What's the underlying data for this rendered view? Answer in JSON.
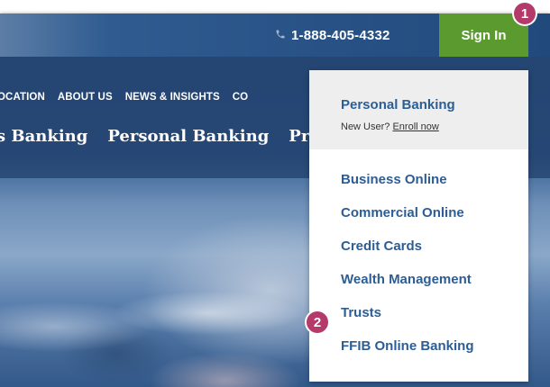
{
  "header": {
    "phone": "1-888-405-4332",
    "phone_icon": "phone-icon",
    "sign_in": "Sign In"
  },
  "nav": {
    "row1": [
      "OCATION",
      "ABOUT US",
      "NEWS & INSIGHTS",
      "CO"
    ],
    "row2": [
      "s Banking",
      "Personal Banking",
      "Pri"
    ]
  },
  "dropdown": {
    "title": "Personal Banking",
    "new_user": "New User?",
    "enroll": "Enroll now",
    "items": [
      "Business Online",
      "Commercial Online",
      "Credit Cards",
      "Wealth Management",
      "Trusts",
      "FFIB Online Banking"
    ]
  },
  "badges": [
    "1",
    "2"
  ],
  "colors": {
    "accent_green": "#5a9a2f",
    "link_blue": "#2c5d94",
    "badge": "#b43a6a",
    "header_blue": "#21497c"
  }
}
